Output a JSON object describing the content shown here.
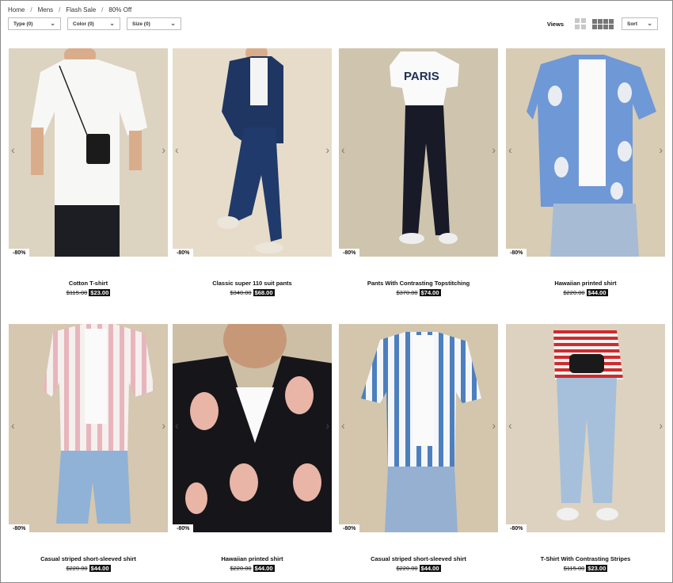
{
  "breadcrumb": [
    "Home",
    "Mens",
    "Flash Sale",
    "80% Off"
  ],
  "filters": [
    {
      "label": "Type (0)"
    },
    {
      "label": "Color (0)"
    },
    {
      "label": "Size (0)"
    }
  ],
  "views_label": "Views",
  "sort_label": "Sort",
  "products": [
    {
      "name": "Cotton T-shirt",
      "old_price": "$115.00",
      "new_price": "$23.00",
      "badge": "-80%"
    },
    {
      "name": "Classic super 110 suit pants",
      "old_price": "$340.00",
      "new_price": "$68.00",
      "badge": "-80%"
    },
    {
      "name": "Pants With Contrasting Topstitching",
      "old_price": "$370.00",
      "new_price": "$74.00",
      "badge": "-80%"
    },
    {
      "name": "Hawaiian printed shirt",
      "old_price": "$220.00",
      "new_price": "$44.00",
      "badge": "-80%"
    },
    {
      "name": "Casual striped short-sleeved shirt",
      "old_price": "$220.00",
      "new_price": "$44.00",
      "badge": "-80%"
    },
    {
      "name": "Hawaiian printed shirt",
      "old_price": "$220.00",
      "new_price": "$44.00",
      "badge": "-80%"
    },
    {
      "name": "Casual striped short-sleeved shirt",
      "old_price": "$220.00",
      "new_price": "$44.00",
      "badge": "-80%"
    },
    {
      "name": "T-Shirt With Contrasting Stripes",
      "old_price": "$115.00",
      "new_price": "$23.00",
      "badge": "-80%"
    }
  ]
}
